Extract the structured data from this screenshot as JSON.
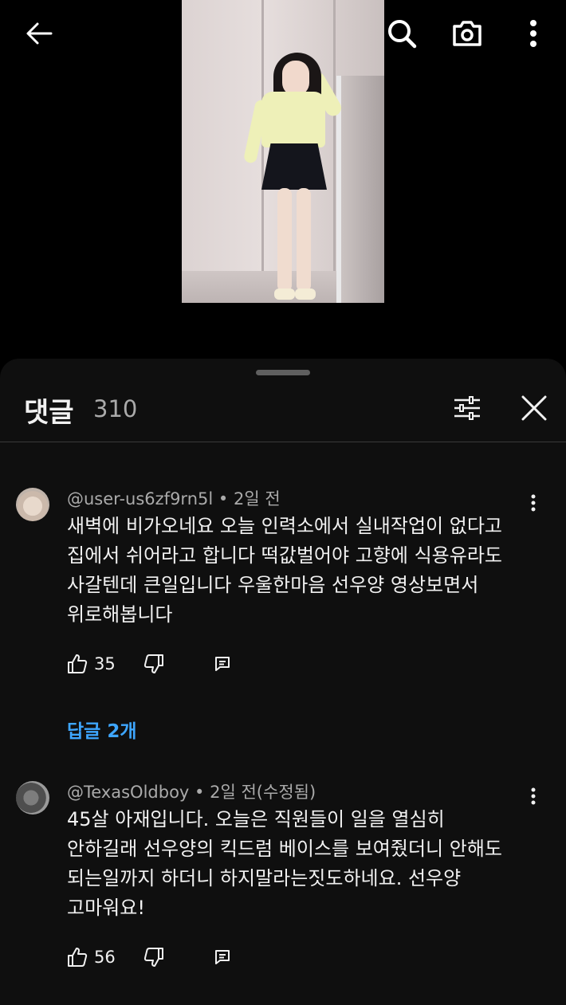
{
  "comments_panel": {
    "title": "댓글",
    "count": "310"
  },
  "comments": [
    {
      "author": "@user-us6zf9rn5l",
      "time": "2일 전",
      "lines": [
        "새벽에 비가오네요 오늘 인력소에서 실내작업이 없다고",
        "집에서 쉬어라고 합니다 떡값벌어야 고향에 식용유라도",
        "사갈텐데 큰일입니다 우울한마음 선우양 영상보면서",
        "위로해봅니다"
      ],
      "likes": "35",
      "replies_label": "답글 2개"
    },
    {
      "author": "@TexasOldboy",
      "time": "2일 전(수정됨)",
      "lines": [
        "45살 아재입니다. 오늘은 직원들이 일을 열심히",
        "안하길래 선우양의 킥드럼 베이스를 보여줬더니 안해도",
        "되는일까지 하더니 하지말라는짓도하네요. 선우양",
        "고마워요!"
      ],
      "likes": "56"
    }
  ],
  "meta_separator": "•",
  "icons": [
    "back-arrow-icon",
    "search-icon",
    "camera-icon",
    "more-vert-icon",
    "filter-icon",
    "close-icon",
    "thumbs-up-icon",
    "thumbs-down-icon",
    "reply-icon"
  ],
  "colors": {
    "link": "#3ea6ff",
    "sheet_bg": "#0f0f0f",
    "secondary_text": "#aaaaaa"
  }
}
